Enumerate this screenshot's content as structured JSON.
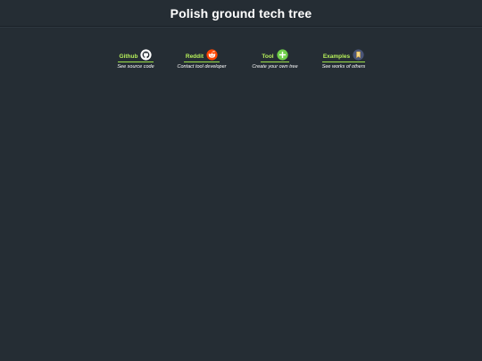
{
  "header": {
    "title": "Polish ground tech tree"
  },
  "links": [
    {
      "label": "Github",
      "description": "See source code",
      "icon": "github-icon"
    },
    {
      "label": "Reddit",
      "description": "Contact tool developer",
      "icon": "reddit-icon"
    },
    {
      "label": "Tool",
      "description": "Create your own tree",
      "icon": "plus-icon"
    },
    {
      "label": "Examples",
      "description": "See works of others",
      "icon": "bookmark-icon"
    }
  ],
  "colors": {
    "background": "#252d34",
    "link_accent": "#b6f05a",
    "reddit": "#ff4500",
    "plus": "#6fcf4a",
    "bookmark_bg": "#4a5578",
    "bookmark": "#f2c14e"
  }
}
